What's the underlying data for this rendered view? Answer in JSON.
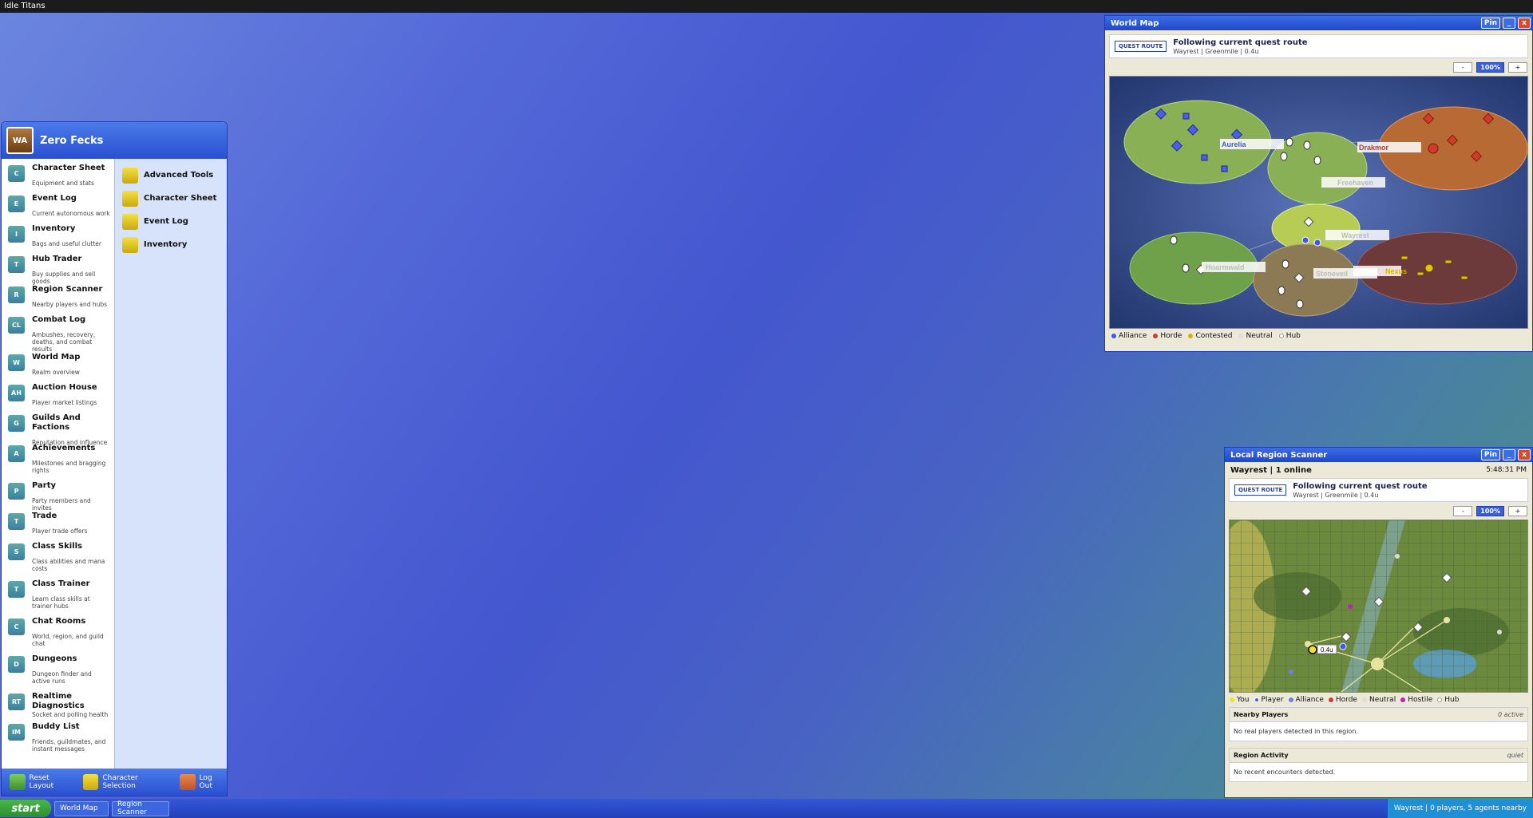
{
  "app_title": "Idle Titans",
  "world_map": {
    "title": "World Map",
    "pin": "Pin",
    "minimize": "_",
    "close": "x",
    "route_tag": "QUEST ROUTE",
    "route_title": "Following current quest route",
    "route_detail": "Wayrest | Greenmile | 0.4u",
    "zoom_minus": "-",
    "zoom_level": "100%",
    "zoom_plus": "+",
    "regions": [
      "Aurelia",
      "Drakmor",
      "Freehaven",
      "Wayrest",
      "Hoarmwald",
      "Stoneveil",
      "Nexus"
    ],
    "legend": [
      {
        "label": "Alliance",
        "color": "#3a5be8"
      },
      {
        "label": "Horde",
        "color": "#d23a2a"
      },
      {
        "label": "Contested",
        "color": "#d4b30a"
      },
      {
        "label": "Neutral",
        "color": "#dddddd"
      },
      {
        "label": "Hub",
        "color": "#ffffff"
      }
    ]
  },
  "start_menu": {
    "avatar": "WA",
    "name": "Zero Fecks",
    "items": [
      {
        "icon": "C",
        "title": "Character Sheet",
        "subtitle": "Equipment and stats"
      },
      {
        "icon": "E",
        "title": "Event Log",
        "subtitle": "Current autonomous work"
      },
      {
        "icon": "I",
        "title": "Inventory",
        "subtitle": "Bags and useful clutter"
      },
      {
        "icon": "T",
        "title": "Hub Trader",
        "subtitle": "Buy supplies and sell goods"
      },
      {
        "icon": "R",
        "title": "Region Scanner",
        "subtitle": "Nearby players and hubs"
      },
      {
        "icon": "CL",
        "title": "Combat Log",
        "subtitle": "Ambushes, recovery, deaths, and combat results"
      },
      {
        "icon": "W",
        "title": "World Map",
        "subtitle": "Realm overview"
      },
      {
        "icon": "AH",
        "title": "Auction House",
        "subtitle": "Player market listings"
      },
      {
        "icon": "G",
        "title": "Guilds And Factions",
        "subtitle": "Reputation and influence"
      },
      {
        "icon": "A",
        "title": "Achievements",
        "subtitle": "Milestones and bragging rights"
      },
      {
        "icon": "P",
        "title": "Party",
        "subtitle": "Party members and invites"
      },
      {
        "icon": "T",
        "title": "Trade",
        "subtitle": "Player trade offers"
      },
      {
        "icon": "S",
        "title": "Class Skills",
        "subtitle": "Class abilities and mana costs"
      },
      {
        "icon": "T",
        "title": "Class Trainer",
        "subtitle": "Learn class skills at trainer hubs"
      },
      {
        "icon": "C",
        "title": "Chat Rooms",
        "subtitle": "World, region, and guild chat"
      },
      {
        "icon": "D",
        "title": "Dungeons",
        "subtitle": "Dungeon finder and active runs"
      },
      {
        "icon": "RT",
        "title": "Realtime Diagnostics",
        "subtitle": "Socket and polling health"
      },
      {
        "icon": "IM",
        "title": "Buddy List",
        "subtitle": "Friends, guildmates, and instant messages"
      }
    ],
    "right_items": [
      "Advanced Tools",
      "Character Sheet",
      "Event Log",
      "Inventory"
    ],
    "footer": [
      "Reset Layout",
      "Character Selection",
      "Log Out"
    ]
  },
  "scanner": {
    "title": "Local Region Scanner",
    "pin": "Pin",
    "minimize": "_",
    "close": "x",
    "region_status": "Wayrest | 1 online",
    "time": "5:48:31 PM",
    "route_tag": "QUEST ROUTE",
    "route_title": "Following current quest route",
    "route_detail": "Wayrest | Greenmile | 0.4u",
    "zoom_minus": "-",
    "zoom_level": "100%",
    "zoom_plus": "+",
    "distance_label": "0.4u",
    "legend": [
      {
        "label": "You",
        "color": "#f0e030"
      },
      {
        "label": "Player",
        "color": "#3a5be8"
      },
      {
        "label": "Alliance",
        "color": "#6c7fe8"
      },
      {
        "label": "Horde",
        "color": "#d23a2a"
      },
      {
        "label": "Neutral",
        "color": "#dddddd"
      },
      {
        "label": "Hostile",
        "color": "#c020c0"
      },
      {
        "label": "Hub",
        "color": "#ffffff"
      }
    ],
    "nearby_title": "Nearby Players",
    "nearby_count": "0 active",
    "nearby_empty": "No real players detected in this region.",
    "activity_title": "Region Activity",
    "activity_status": "quiet",
    "activity_empty": "No recent encounters detected."
  },
  "taskbar": {
    "start": "start",
    "items": [
      "World Map",
      "Region Scanner"
    ],
    "tray": "Wayrest | 0 players, 5 agents nearby"
  }
}
